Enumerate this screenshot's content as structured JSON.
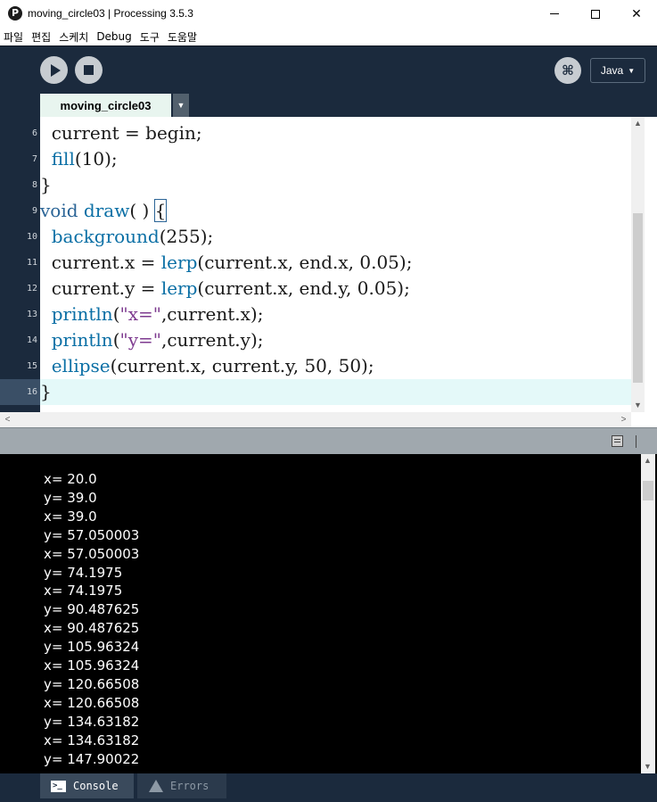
{
  "window": {
    "title": "moving_circle03 | Processing 3.5.3",
    "app_icon_glyph": "P",
    "minimize_icon": "minimize-icon",
    "maximize_icon": "maximize-icon",
    "close_glyph": "✕"
  },
  "menu": [
    "파일",
    "편집",
    "스케치",
    "Debug",
    "도구",
    "도움말"
  ],
  "toolbar": {
    "run_icon": "play-icon",
    "stop_icon": "stop-icon",
    "debug_glyph": "⌘",
    "mode_label": "Java",
    "mode_caret": "▼"
  },
  "tabs": {
    "active_label": "moving_circle03",
    "menu_glyph": "▼"
  },
  "editor": {
    "lines": [
      {
        "num": "6",
        "segments": [
          {
            "t": "  current = begin;",
            "c": ""
          }
        ]
      },
      {
        "num": "7",
        "segments": [
          {
            "t": "  ",
            "c": ""
          },
          {
            "t": "fill",
            "c": "fn"
          },
          {
            "t": "(10);",
            "c": ""
          }
        ]
      },
      {
        "num": "8",
        "segments": [
          {
            "t": "}",
            "c": ""
          }
        ]
      },
      {
        "num": "9",
        "segments": [
          {
            "t": "void",
            "c": "kw"
          },
          {
            "t": " ",
            "c": ""
          },
          {
            "t": "draw",
            "c": "fn"
          },
          {
            "t": "( ) ",
            "c": ""
          },
          {
            "t": "{",
            "c": "bracket"
          }
        ]
      },
      {
        "num": "10",
        "segments": [
          {
            "t": "  ",
            "c": ""
          },
          {
            "t": "background",
            "c": "fn"
          },
          {
            "t": "(255);",
            "c": ""
          }
        ]
      },
      {
        "num": "11",
        "segments": [
          {
            "t": "  current.x = ",
            "c": ""
          },
          {
            "t": "lerp",
            "c": "fn"
          },
          {
            "t": "(current.x, end.x, 0.05);",
            "c": ""
          }
        ]
      },
      {
        "num": "12",
        "segments": [
          {
            "t": "  current.y = ",
            "c": ""
          },
          {
            "t": "lerp",
            "c": "fn"
          },
          {
            "t": "(current.x, end.y, 0.05);",
            "c": ""
          }
        ]
      },
      {
        "num": "13",
        "segments": [
          {
            "t": "  ",
            "c": ""
          },
          {
            "t": "println",
            "c": "fn"
          },
          {
            "t": "(",
            "c": ""
          },
          {
            "t": "\"x=\"",
            "c": "str"
          },
          {
            "t": ",current.x);",
            "c": ""
          }
        ]
      },
      {
        "num": "14",
        "segments": [
          {
            "t": "  ",
            "c": ""
          },
          {
            "t": "println",
            "c": "fn"
          },
          {
            "t": "(",
            "c": ""
          },
          {
            "t": "\"y=\"",
            "c": "str"
          },
          {
            "t": ",current.y);",
            "c": ""
          }
        ]
      },
      {
        "num": "15",
        "segments": [
          {
            "t": "  ",
            "c": ""
          },
          {
            "t": "ellipse",
            "c": "fn"
          },
          {
            "t": "(current.x, current.y, 50, 50);",
            "c": ""
          }
        ]
      },
      {
        "num": "16",
        "segments": [
          {
            "t": "}",
            "c": ""
          }
        ],
        "current": true
      }
    ],
    "scroll_up": "▲",
    "scroll_down": "▼",
    "scroll_left": "<",
    "scroll_right": ">"
  },
  "console": {
    "lines": [
      "x= 20.0",
      "y= 39.0",
      "x= 39.0",
      "y= 57.050003",
      "x= 57.050003",
      "y= 74.1975",
      "x= 74.1975",
      "y= 90.487625",
      "x= 90.487625",
      "y= 105.96324",
      "x= 105.96324",
      "y= 120.66508",
      "x= 120.66508",
      "y= 134.63182",
      "x= 134.63182",
      "y= 147.90022"
    ],
    "scroll_up": "▲",
    "scroll_down": "▼"
  },
  "bottom_tabs": {
    "console_label": "Console",
    "console_icon_glyph": ">_",
    "errors_label": "Errors"
  },
  "colors": {
    "toolbar_bg": "#1b2a3d",
    "tab_active_bg": "#e8f5ef",
    "current_line_bg": "#e4f9f9",
    "keyword": "#2a6496",
    "function": "#0a6fa5",
    "string": "#7d3a8f",
    "console_bg": "#000000"
  }
}
